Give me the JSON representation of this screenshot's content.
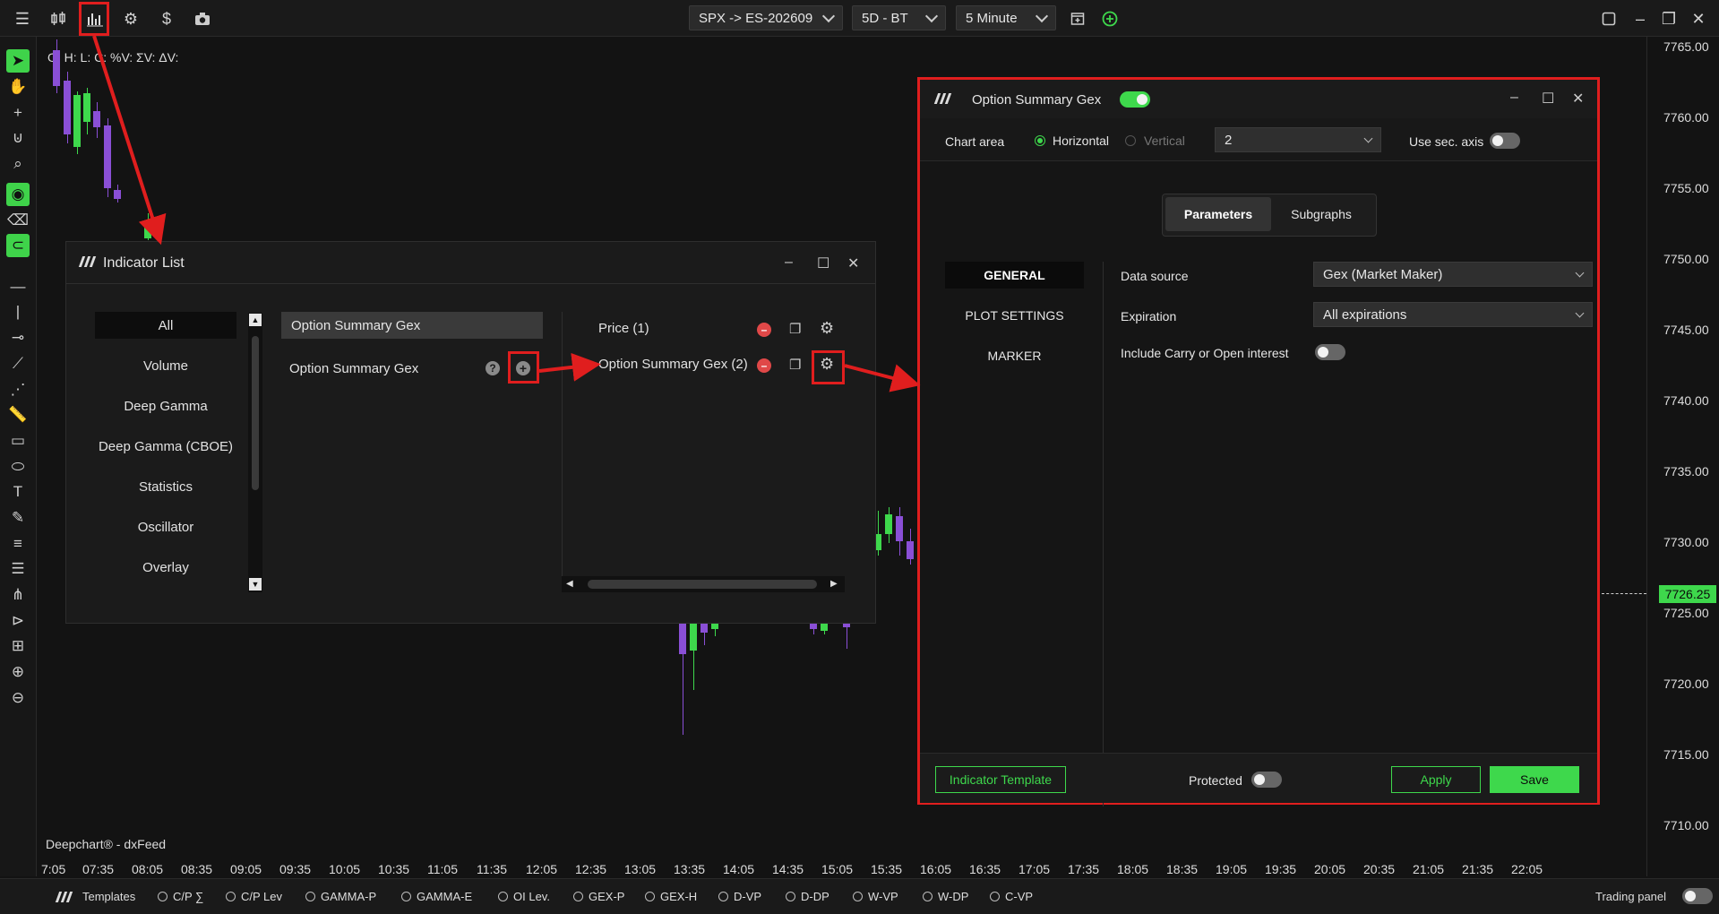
{
  "topbar": {
    "symbol": "SPX -> ES-202609",
    "period": "5D - BT",
    "interval": "5 Minute"
  },
  "ohlc_label": "O: H: L: C: %V: ΣV: ΔV:",
  "source_label": "Deepchart® - dxFeed",
  "price_axis": [
    "7765.00",
    "7760.00",
    "7755.00",
    "7750.00",
    "7745.00",
    "7740.00",
    "7735.00",
    "7730.00",
    "7725.00",
    "7720.00",
    "7715.00",
    "7710.00"
  ],
  "current_price": "7726.25",
  "time_axis": [
    "7:05",
    "07:35",
    "08:05",
    "08:35",
    "09:05",
    "09:35",
    "10:05",
    "10:35",
    "11:05",
    "11:35",
    "12:05",
    "12:35",
    "13:05",
    "13:35",
    "14:05",
    "14:35",
    "15:05",
    "15:35",
    "16:05",
    "16:35",
    "17:05",
    "17:35",
    "18:05",
    "18:35",
    "19:05",
    "19:35",
    "20:05",
    "20:35",
    "21:05",
    "21:35",
    "22:05"
  ],
  "bottombar": {
    "templates": "Templates",
    "items": [
      "C/P ∑",
      "C/P Lev",
      "GAMMA-P",
      "GAMMA-E",
      "OI Lev.",
      "GEX-P",
      "GEX-H",
      "D-VP",
      "D-DP",
      "W-VP",
      "W-DP",
      "C-VP"
    ],
    "trading_panel": "Trading panel"
  },
  "indicator_list": {
    "title": "Indicator List",
    "categories": [
      "All",
      "Volume",
      "Deep Gamma",
      "Deep Gamma (CBOE)",
      "Statistics",
      "Oscillator",
      "Overlay"
    ],
    "search_value": "Option Summary Gex",
    "result": "Option Summary Gex",
    "added": [
      "Price (1)",
      "Option Summary Gex (2)"
    ]
  },
  "settings": {
    "title": "Option Summary Gex",
    "chart_area_label": "Chart area",
    "horizontal": "Horizontal",
    "vertical": "Vertical",
    "area_value": "2",
    "sec_axis_label": "Use sec. axis",
    "tabs": [
      "Parameters",
      "Subgraphs"
    ],
    "nav": [
      "GENERAL",
      "PLOT SETTINGS",
      "MARKER"
    ],
    "data_source_label": "Data source",
    "data_source_value": "Gex (Market Maker)",
    "expiration_label": "Expiration",
    "expiration_value": "All expirations",
    "carry_label": "Include Carry or Open interest",
    "template_btn": "Indicator Template",
    "protected_label": "Protected",
    "apply_btn": "Apply",
    "save_btn": "Save"
  }
}
